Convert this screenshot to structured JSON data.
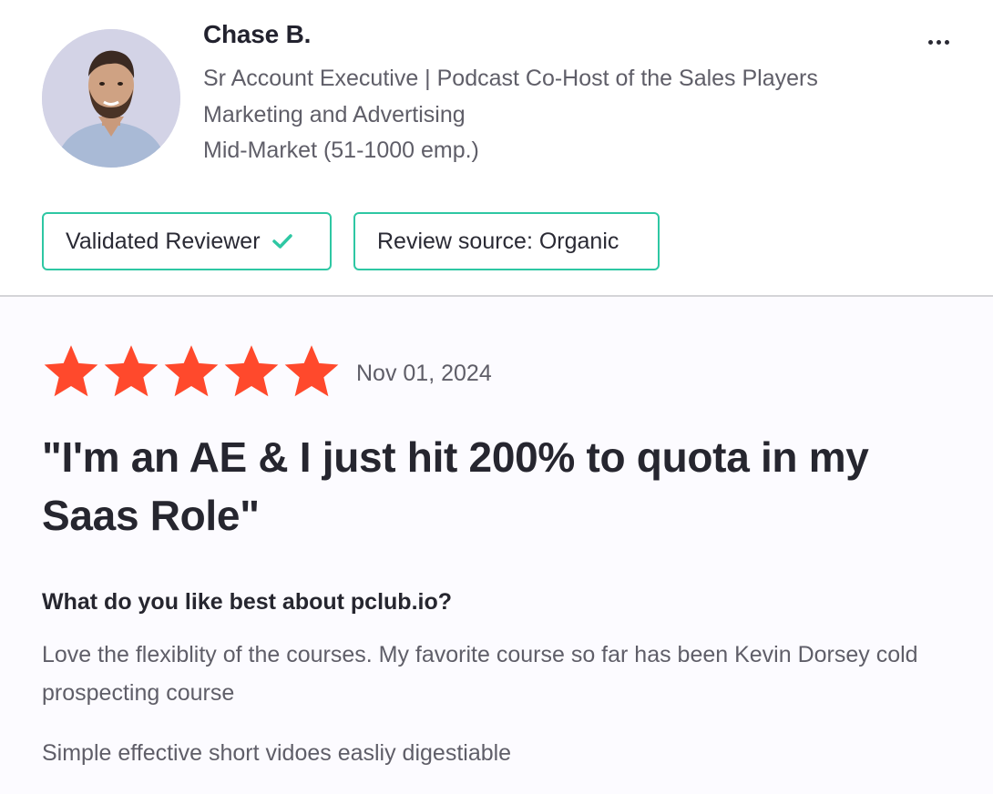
{
  "reviewer": {
    "name": "Chase B.",
    "title": "Sr Account Executive | Podcast Co-Host of the Sales Players",
    "industry": "Marketing and Advertising",
    "company_size": "Mid-Market (51-1000 emp.)",
    "avatar_icon": "person-avatar"
  },
  "menu": {
    "icon": "more-horizontal-icon"
  },
  "badges": {
    "validated_label": "Validated Reviewer",
    "validated_icon": "check-icon",
    "source_label": "Review source: Organic"
  },
  "review": {
    "rating": 5,
    "rating_max": 5,
    "date": "Nov 01, 2024",
    "title": "\"I'm an AE & I just hit 200% to quota in my Saas Role\"",
    "question": "What do you like best about pclub.io?",
    "answers": [
      "Love the flexiblity of the courses. My favorite course so far has been Kevin Dorsey cold prospecting course",
      "Simple effective short vidoes easliy digestiable"
    ]
  },
  "colors": {
    "accent_border": "#2ec7a3",
    "star": "#ff492c",
    "text_primary": "#26262f",
    "text_secondary": "#5f5e68",
    "divider": "#d4d4d8"
  }
}
